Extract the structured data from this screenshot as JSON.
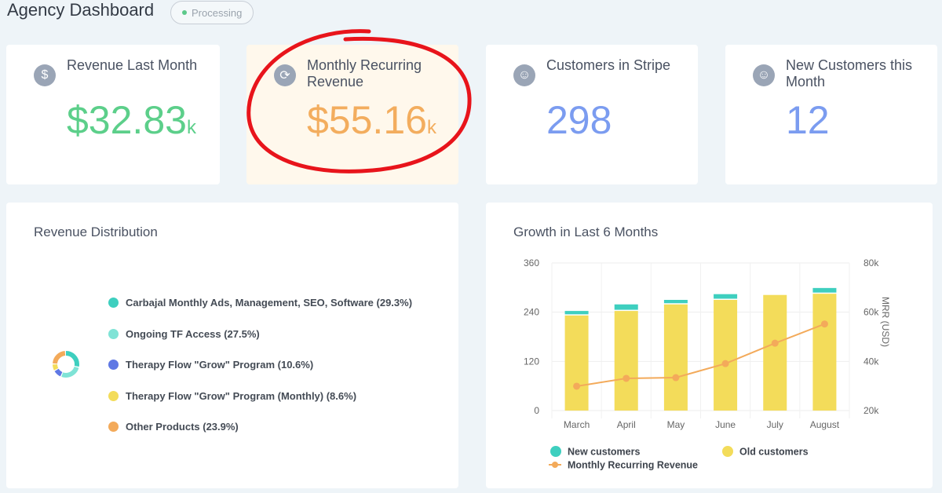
{
  "header": {
    "title": "Agency Dashboard",
    "status": "Processing"
  },
  "kpis": [
    {
      "icon": "dollar-icon",
      "label": "Revenue Last Month",
      "value": "$32.83",
      "suffix": "k",
      "color": "#5ccf8a"
    },
    {
      "icon": "refresh-icon",
      "label": "Monthly Recurring Revenue",
      "value": "$55.16",
      "suffix": "k",
      "color": "#f3ad5e"
    },
    {
      "icon": "users-icon",
      "label": "Customers in Stripe",
      "value": "298",
      "suffix": "",
      "color": "#7b9cf0"
    },
    {
      "icon": "new-user-icon",
      "label": "New Customers this Month",
      "value": "12",
      "suffix": "",
      "color": "#7b9cf0"
    }
  ],
  "revenue_distribution": {
    "title": "Revenue Distribution"
  },
  "growth": {
    "title": "Growth in Last 6 Months"
  },
  "chart_data": [
    {
      "type": "pie",
      "title": "Revenue Distribution",
      "donut": true,
      "slices": [
        {
          "label": "Carbajal Monthly Ads, Management, SEO, Software (29.3%)",
          "value": 29.3,
          "color": "#3ecfbf"
        },
        {
          "label": "Ongoing TF Access (27.5%)",
          "value": 27.5,
          "color": "#7fe3d6"
        },
        {
          "label": "Therapy Flow \"Grow\" Program (10.6%)",
          "value": 10.6,
          "color": "#5f78e4"
        },
        {
          "label": "Therapy Flow \"Grow\" Program (Monthly) (8.6%)",
          "value": 8.6,
          "color": "#f3dc5a"
        },
        {
          "label": "Other Products (23.9%)",
          "value": 23.9,
          "color": "#f3aa5a"
        }
      ],
      "legend": "right"
    },
    {
      "type": "bar",
      "title": "Growth in Last 6 Months",
      "stacked": true,
      "categories": [
        "March",
        "April",
        "May",
        "June",
        "July",
        "August"
      ],
      "series": [
        {
          "name": "Old customers",
          "values": [
            232,
            243,
            259,
            270,
            282,
            285
          ],
          "color": "#f3dc5a",
          "axis": "left"
        },
        {
          "name": "New customers",
          "values": [
            11,
            16,
            11,
            14,
            0,
            14
          ],
          "color": "#3ecfbf",
          "axis": "left"
        },
        {
          "name": "Monthly Recurring Revenue",
          "type": "line",
          "values": [
            29900,
            33100,
            33400,
            39100,
            47400,
            55200
          ],
          "color": "#f3aa5a",
          "axis": "right"
        }
      ],
      "ylim": [
        0,
        360
      ],
      "yticks": [
        "0",
        "120",
        "240",
        "360"
      ],
      "y2lim": [
        20000,
        80000
      ],
      "y2ticks": [
        "20k",
        "40k",
        "60k",
        "80k"
      ],
      "y2label": "MRR (USD)",
      "legend": "bottom",
      "grid": true
    }
  ]
}
